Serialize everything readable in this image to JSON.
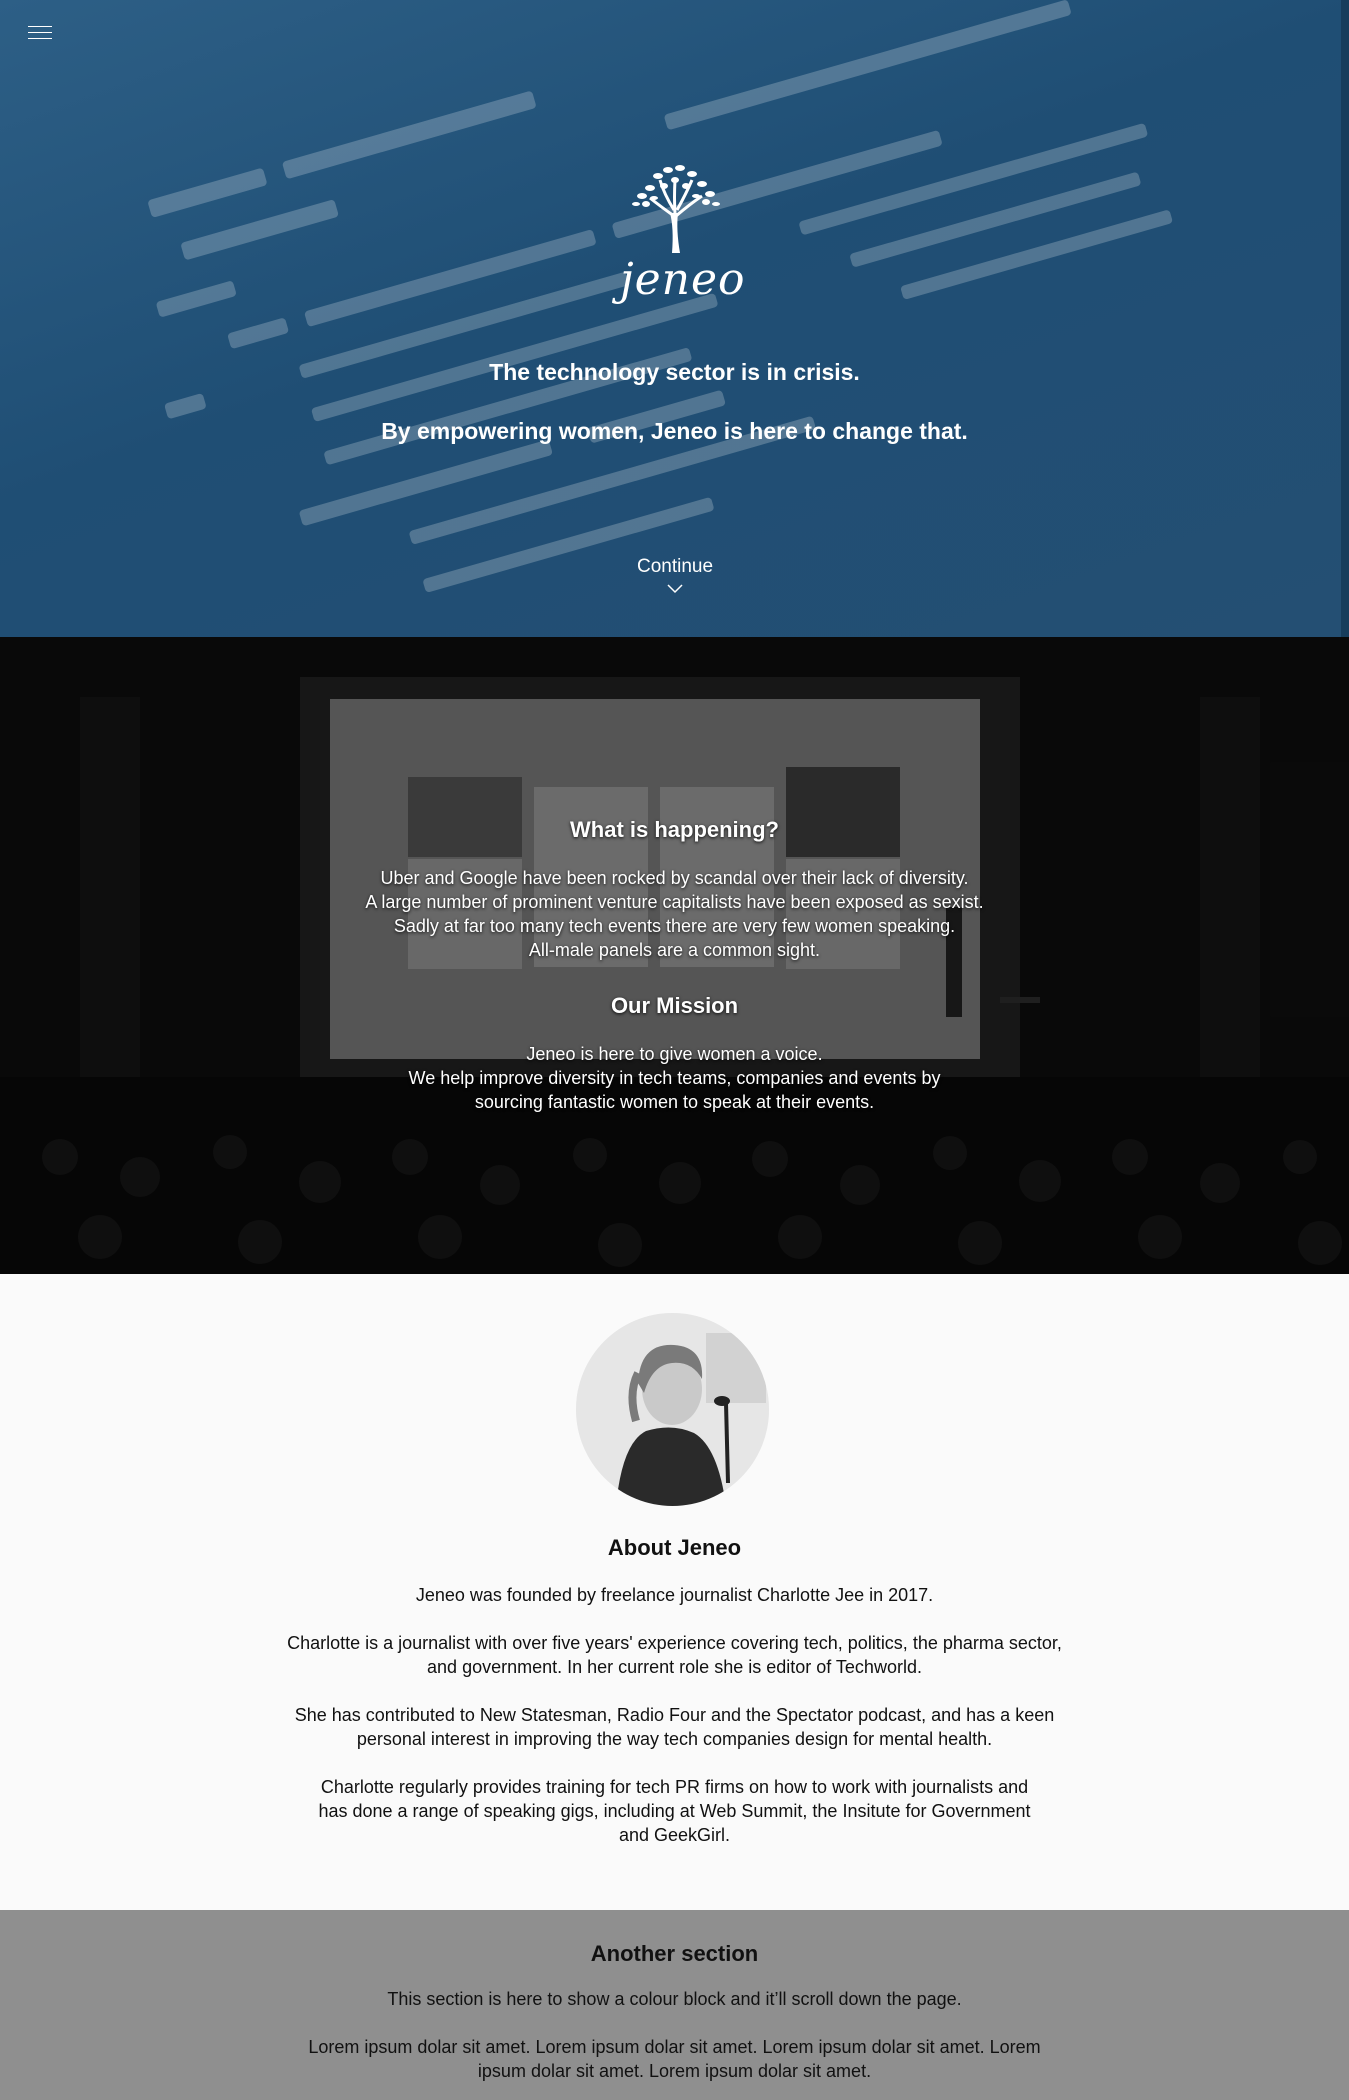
{
  "hero": {
    "logo_text": "jeneo",
    "line1": "The technology sector is in crisis.",
    "line2": "By empowering women, Jeneo is here to change that.",
    "continue_label": "Continue"
  },
  "happening": {
    "title": "What is happening?",
    "lines": [
      "Uber and Google have been rocked by scandal over their lack of diversity.",
      "A large number of prominent venture capitalists have been exposed as sexist.",
      "Sadly at far too many tech events there are very few women speaking.",
      "All-male panels are a common sight."
    ]
  },
  "mission": {
    "title": "Our Mission",
    "lines": [
      "Jeneo is here to give women a voice.",
      "We help improve diversity in tech teams, companies and events by",
      "sourcing fantastic women to speak at their events."
    ]
  },
  "about": {
    "title": "About Jeneo",
    "p1": [
      "Jeneo was founded by freelance journalist Charlotte Jee in 2017."
    ],
    "p2": [
      "Charlotte is a journalist with over five years' experience covering tech, politics, the pharma sector,",
      "and government. In her current role she is editor of Techworld."
    ],
    "p3": [
      "She has contributed to New Statesman, Radio Four and the Spectator podcast, and has a keen",
      "personal interest in improving the way tech companies design for mental health."
    ],
    "p4": [
      "Charlotte regularly provides training for tech PR firms on how to work with journalists and",
      "has done a range of speaking gigs, including at Web Summit, the Insitute for Government",
      "and GeekGirl."
    ]
  },
  "another": {
    "title": "Another section",
    "p1": [
      "This section is here to show a colour block and it’ll scroll down the page."
    ],
    "p2": [
      "Lorem ipsum dolar sit amet. Lorem ipsum dolar sit amet. Lorem ipsum dolar sit amet. Lorem",
      "ipsum dolar sit amet. Lorem ipsum dolar sit amet."
    ]
  },
  "icons": {
    "menu": "hamburger-icon",
    "continue": "chevron-down-icon",
    "logo": "tree-icon"
  },
  "colors": {
    "hero_blue": "#1f4e74",
    "grey_block": "#8f8f8f",
    "page_bg": "#fafafa"
  }
}
